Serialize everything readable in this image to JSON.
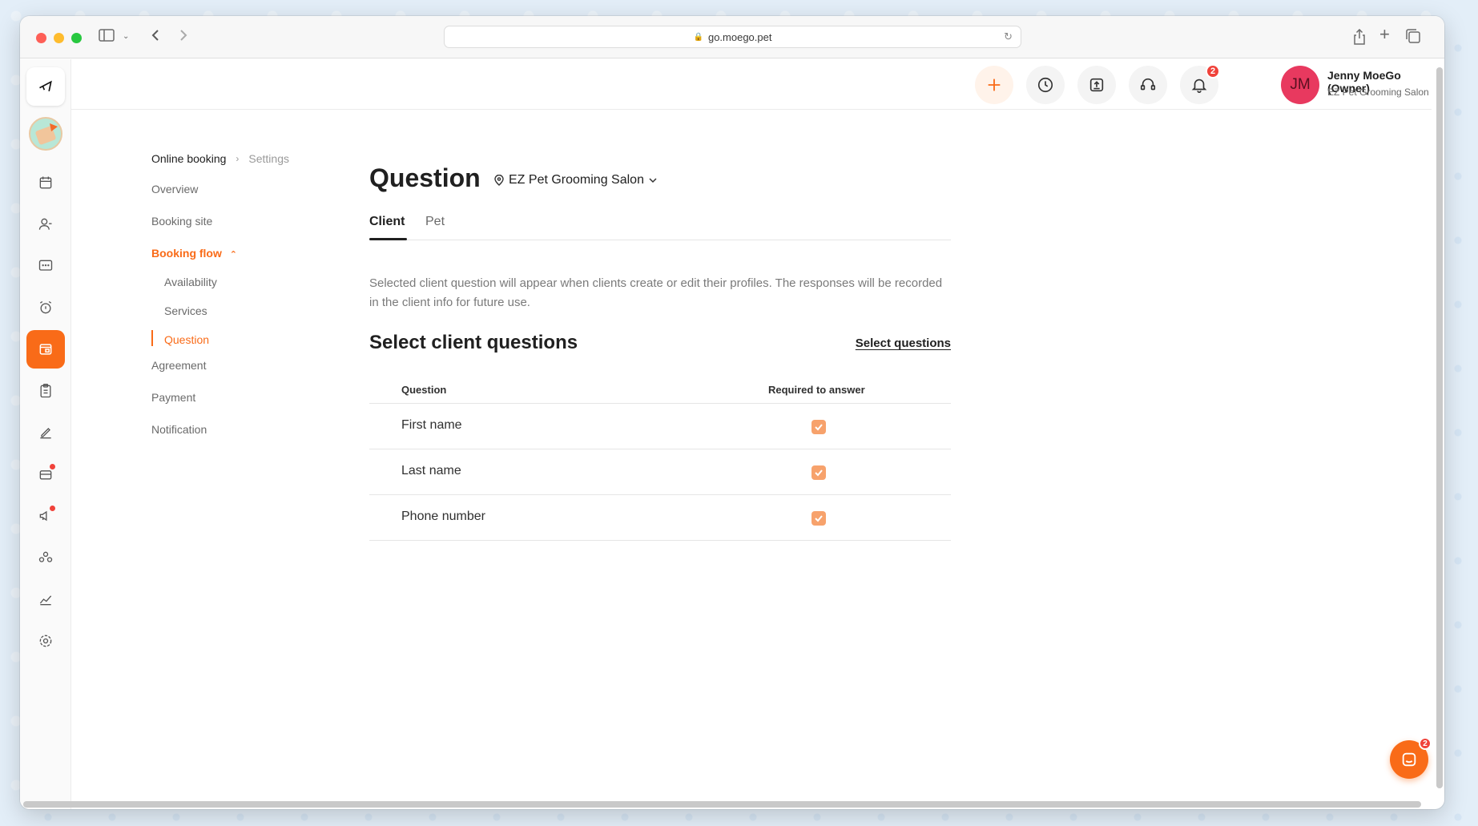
{
  "browser": {
    "url": "go.moego.pet"
  },
  "rail": {
    "items": [
      {
        "icon": "logo-icon"
      },
      {
        "icon": "business-avatar"
      },
      {
        "icon": "calendar-icon"
      },
      {
        "icon": "clients-icon"
      },
      {
        "icon": "message-icon"
      },
      {
        "icon": "alarm-icon"
      },
      {
        "icon": "online-booking-icon",
        "active": true
      },
      {
        "icon": "clipboard-icon"
      },
      {
        "icon": "edit-icon"
      },
      {
        "icon": "retail-icon",
        "dot": true
      },
      {
        "icon": "marketing-icon",
        "dot": true
      },
      {
        "icon": "staff-icon"
      },
      {
        "icon": "reports-icon"
      },
      {
        "icon": "settings-icon"
      }
    ]
  },
  "topbar": {
    "notifications_count": "2",
    "user_initials": "JM",
    "user_name": "Jenny MoeGo (Owner)",
    "business": "EZ Pet Grooming Salon",
    "accent_color": "#f96b18",
    "avatar_color": "#e8395f"
  },
  "breadcrumb": {
    "root": "Online booking",
    "current": "Settings"
  },
  "subnav": {
    "overview": "Overview",
    "booking_site": "Booking site",
    "booking_flow": "Booking flow",
    "availability": "Availability",
    "services": "Services",
    "question": "Question",
    "agreement": "Agreement",
    "payment": "Payment",
    "notification": "Notification"
  },
  "page": {
    "title": "Question",
    "location": "EZ Pet Grooming Salon",
    "tabs": [
      "Client",
      "Pet"
    ],
    "active_tab": "Client",
    "description": "Selected client question will appear when clients create or edit their profiles. The responses will be recorded in the client info for future use.",
    "section_title": "Select client questions",
    "select_link": "Select questions"
  },
  "table": {
    "headers": [
      "Question",
      "Required to answer"
    ],
    "rows": [
      {
        "question": "First name",
        "required": true
      },
      {
        "question": "Last name",
        "required": true
      },
      {
        "question": "Phone number",
        "required": true
      }
    ]
  },
  "chat": {
    "badge": "2"
  }
}
